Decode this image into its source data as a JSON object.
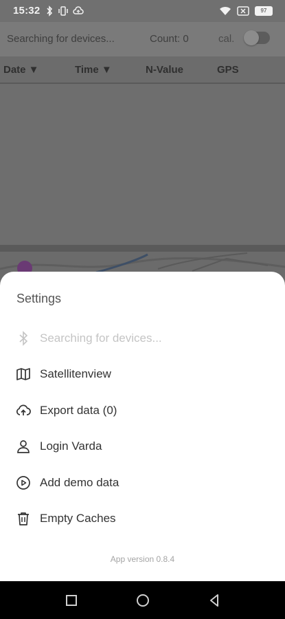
{
  "status_bar": {
    "time": "15:32",
    "icons": [
      "bluetooth-icon",
      "vibrate-icon",
      "cloud-icon",
      "wifi-icon",
      "sim-none-icon",
      "battery-icon"
    ],
    "battery": "97"
  },
  "app": {
    "search_status": "Searching for devices...",
    "count": "Count: 0",
    "cal_label": "cal.",
    "cal_enabled": false
  },
  "table": {
    "columns": [
      "Date ▼",
      "Time ▼",
      "N-Value",
      "GPS"
    ],
    "rows": []
  },
  "settings": {
    "title": "Settings",
    "items": [
      {
        "icon": "bluetooth-icon",
        "label": "Searching for devices...",
        "enabled": false
      },
      {
        "icon": "map-icon",
        "label": "Satellitenview",
        "enabled": true
      },
      {
        "icon": "cloud-upload-icon",
        "label": "Export data (0)",
        "enabled": true
      },
      {
        "icon": "person-icon",
        "label": "Login Varda",
        "enabled": true
      },
      {
        "icon": "play-circle-icon",
        "label": "Add demo data",
        "enabled": true
      },
      {
        "icon": "trash-icon",
        "label": "Empty Caches",
        "enabled": true
      }
    ],
    "app_version": "App version 0.8.4"
  },
  "nav_bar": {
    "buttons": [
      "recents-square-icon",
      "home-circle-icon",
      "back-triangle-icon"
    ]
  },
  "colors": {
    "sheet_bg": "#ffffff",
    "scrim": "#6f6f6f",
    "disabled_text": "#c4c4c4",
    "menu_text": "#333333"
  }
}
